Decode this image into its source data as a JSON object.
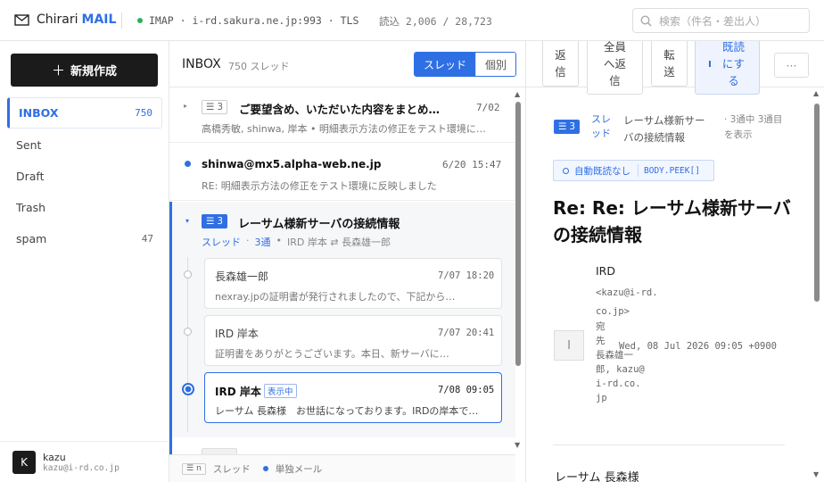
{
  "app": {
    "brand_name": "Chirari",
    "brand_suffix": "MAIL"
  },
  "connection": {
    "status_text": "IMAP · i-rd.sakura.ne.jp:993 · TLS",
    "read_stats": "読込 2,006 / 28,723"
  },
  "search": {
    "placeholder": "検索（件名・差出人）"
  },
  "sidebar": {
    "compose_label": "新規作成",
    "folders": [
      {
        "label": "INBOX",
        "count": "750"
      },
      {
        "label": "Sent",
        "count": ""
      },
      {
        "label": "Draft",
        "count": ""
      },
      {
        "label": "Trash",
        "count": ""
      },
      {
        "label": "spam",
        "count": "47"
      }
    ],
    "account": {
      "initial": "K",
      "name": "kazu",
      "email": "kazu@i-rd.co.jp"
    }
  },
  "list": {
    "folder_title": "INBOX",
    "thread_count": "750 スレッド",
    "view_thread_label": "スレッド",
    "view_single_label": "個別",
    "rows": [
      {
        "badge": "3",
        "subject": "ご要望含め、いただいた内容をまとめ…",
        "date": "7/02",
        "snippet": "高橋秀敏, shinwa, 岸本 • 明細表示方法の修正をテスト環境に…"
      },
      {
        "sender": "shinwa@mx5.alpha-web.ne.jp",
        "date": "6/20 15:47",
        "snippet": "RE: 明細表示方法の修正をテスト環境に反映しました"
      },
      {
        "badge": "3",
        "subject": "レーサム様新サーバの接続情報",
        "meta_thread": "スレッド",
        "meta_count": "3通",
        "meta_people": "IRD 岸本 ⇄ 長森雄一郎"
      }
    ],
    "thread_messages": [
      {
        "sender": "長森雄一郎",
        "date": "7/07 18:20",
        "snippet": "nexray.jpの証明書が発行されましたので、下記から…"
      },
      {
        "sender": "IRD 岸本",
        "date": "7/07 20:41",
        "snippet": "証明書をありがとうございます。本日、新サーバに…"
      },
      {
        "sender": "IRD 岸本",
        "tag": "表示中",
        "date": "7/08 09:05",
        "snippet": "レーサム 長森様　お世話になっております。IRDの岸本で…"
      }
    ],
    "footer": {
      "badge": "n",
      "thread_legend": "スレッド",
      "single_legend": "単独メール"
    }
  },
  "reader": {
    "toolbar": {
      "reply": "返信",
      "reply_all": "全員へ返信",
      "forward": "転送",
      "mark_read": "既読にする",
      "more": "···"
    },
    "thread_badge": "3",
    "thread_link": "スレッド",
    "thread_subject": "レーサム様新サーバの接続情報",
    "thread_position": "· 3通中 3通目を表示",
    "auto_read_label": "自動既読なし",
    "peek_label": "BODY.PEEK[]",
    "subject": "Re: Re: レーサム様新サーバの接続情報",
    "from_name": "IRD",
    "from_email": "<kazu@i-rd.co.jp>",
    "to_label": "宛先",
    "to_value": "長森雄一郎, kazu@i-rd.co.jp",
    "date": "Wed, 08 Jul 2026 09:05 +0900",
    "avatar_initial": "I",
    "body_first_line": "レーサム 長森様"
  },
  "colors": {
    "accent": "#2f6fe4",
    "dark": "#1b1b1b",
    "online": "#2fae5b"
  }
}
